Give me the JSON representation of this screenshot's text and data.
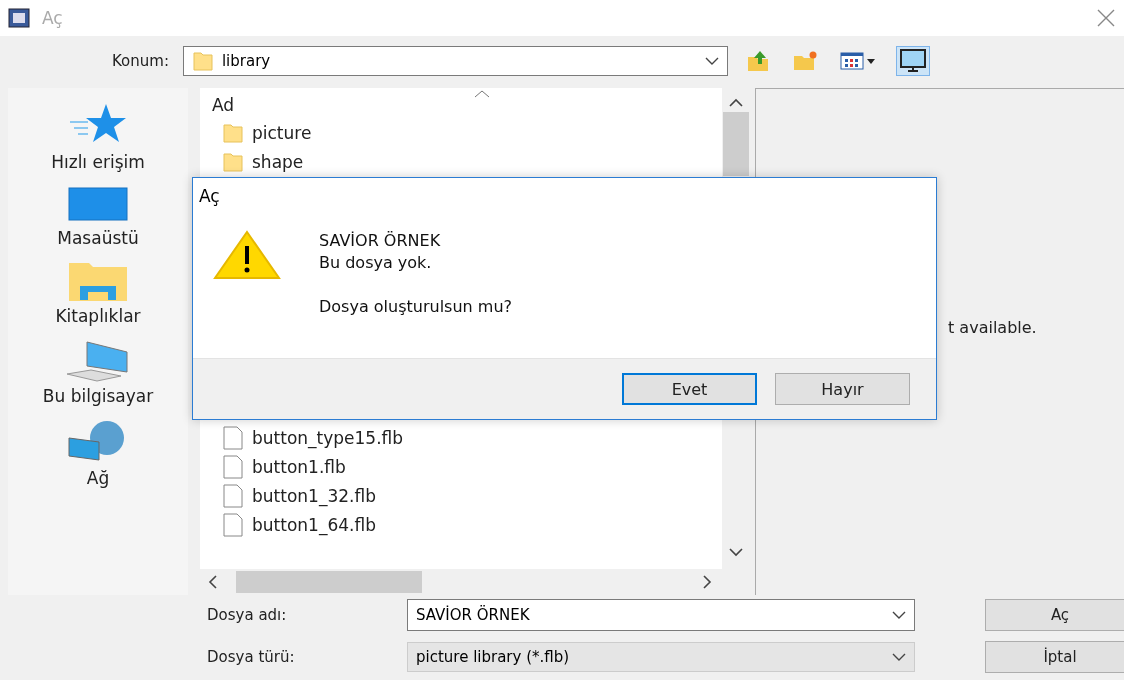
{
  "window": {
    "title": "Aç"
  },
  "location": {
    "label": "Konum:",
    "value": "library"
  },
  "toolbar": [
    {
      "kind": "up",
      "selected": false
    },
    {
      "kind": "newfolder",
      "selected": false
    },
    {
      "kind": "view",
      "selected": false
    },
    {
      "kind": "preview",
      "selected": true
    }
  ],
  "places": [
    {
      "kind": "star",
      "label": "Hızlı erişim"
    },
    {
      "kind": "desktop",
      "label": "Masaüstü"
    },
    {
      "kind": "library",
      "label": "Kitaplıklar"
    },
    {
      "kind": "computer",
      "label": "Bu bilgisayar"
    },
    {
      "kind": "network",
      "label": "Ağ"
    }
  ],
  "file_list": {
    "column": "Ad",
    "items_above_message": [
      {
        "kind": "folder",
        "name": "picture"
      },
      {
        "kind": "folder",
        "name": "shape"
      }
    ],
    "items_below_message": [
      {
        "kind": "file",
        "name": "button_type15.flb"
      },
      {
        "kind": "file",
        "name": "button1.flb"
      },
      {
        "kind": "file",
        "name": "button1_32.flb"
      },
      {
        "kind": "file",
        "name": "button1_64.flb"
      }
    ]
  },
  "preview": {
    "text": "t available."
  },
  "fields": [
    {
      "label": "Dosya adı:",
      "value": "SAVİOR ÖRNEK",
      "disabled": false
    },
    {
      "label": "Dosya türü:",
      "value": "picture library (*.flb)",
      "disabled": true
    }
  ],
  "buttons": [
    "Aç",
    "İptal"
  ],
  "message_box": {
    "title": "Aç",
    "lines": [
      "SAVİOR ÖRNEK",
      "Bu dosya yok."
    ],
    "question": "Dosya oluşturulsun mu?",
    "buttons": [
      {
        "label": "Evet",
        "default": true
      },
      {
        "label": "Hayır",
        "default": false
      }
    ]
  }
}
